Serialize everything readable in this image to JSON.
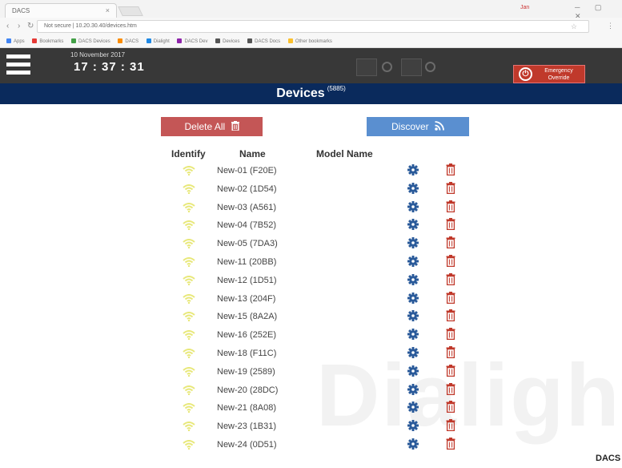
{
  "browser": {
    "tab_title": "DACS",
    "tab_close": "×",
    "window_user": "Jan",
    "window_buttons": "─ ▢ ✕",
    "address": "Not secure | 10.20.30.40/devices.htm",
    "bookmarks": [
      "Apps",
      "Bookmarks",
      "DACS Devices",
      "DACS",
      "Dialight",
      "DACS Dev",
      "Devices",
      "DACS Docs",
      "Other bookmarks"
    ]
  },
  "header": {
    "date": "10 November 2017",
    "time": "17 : 37 : 31",
    "emergency_label": "Emergency Override"
  },
  "page": {
    "title": "Devices",
    "count": "(5885)"
  },
  "actions": {
    "delete_all": "Delete All",
    "discover": "Discover"
  },
  "columns": {
    "identify": "Identify",
    "name": "Name",
    "model": "Model Name"
  },
  "devices": [
    "New-01 (F20E)",
    "New-02 (1D54)",
    "New-03 (A561)",
    "New-04 (7B52)",
    "New-05 (7DA3)",
    "New-11 (20BB)",
    "New-12 (1D51)",
    "New-13 (204F)",
    "New-15 (8A2A)",
    "New-16 (252E)",
    "New-18 (F11C)",
    "New-19 (2589)",
    "New-20 (28DC)",
    "New-21 (8A08)",
    "New-23 (1B31)",
    "New-24 (0D51)"
  ],
  "watermark": "Dialight",
  "footer_brand": "DACS",
  "colors": {
    "header_bg": "#383838",
    "title_bar": "#0a2a5c",
    "delete_btn": "#c45656",
    "discover_btn": "#5a8fd0",
    "identify_icon": "#e8e87a",
    "gear_icon": "#2a5a9a",
    "trash_icon": "#c0392b"
  }
}
